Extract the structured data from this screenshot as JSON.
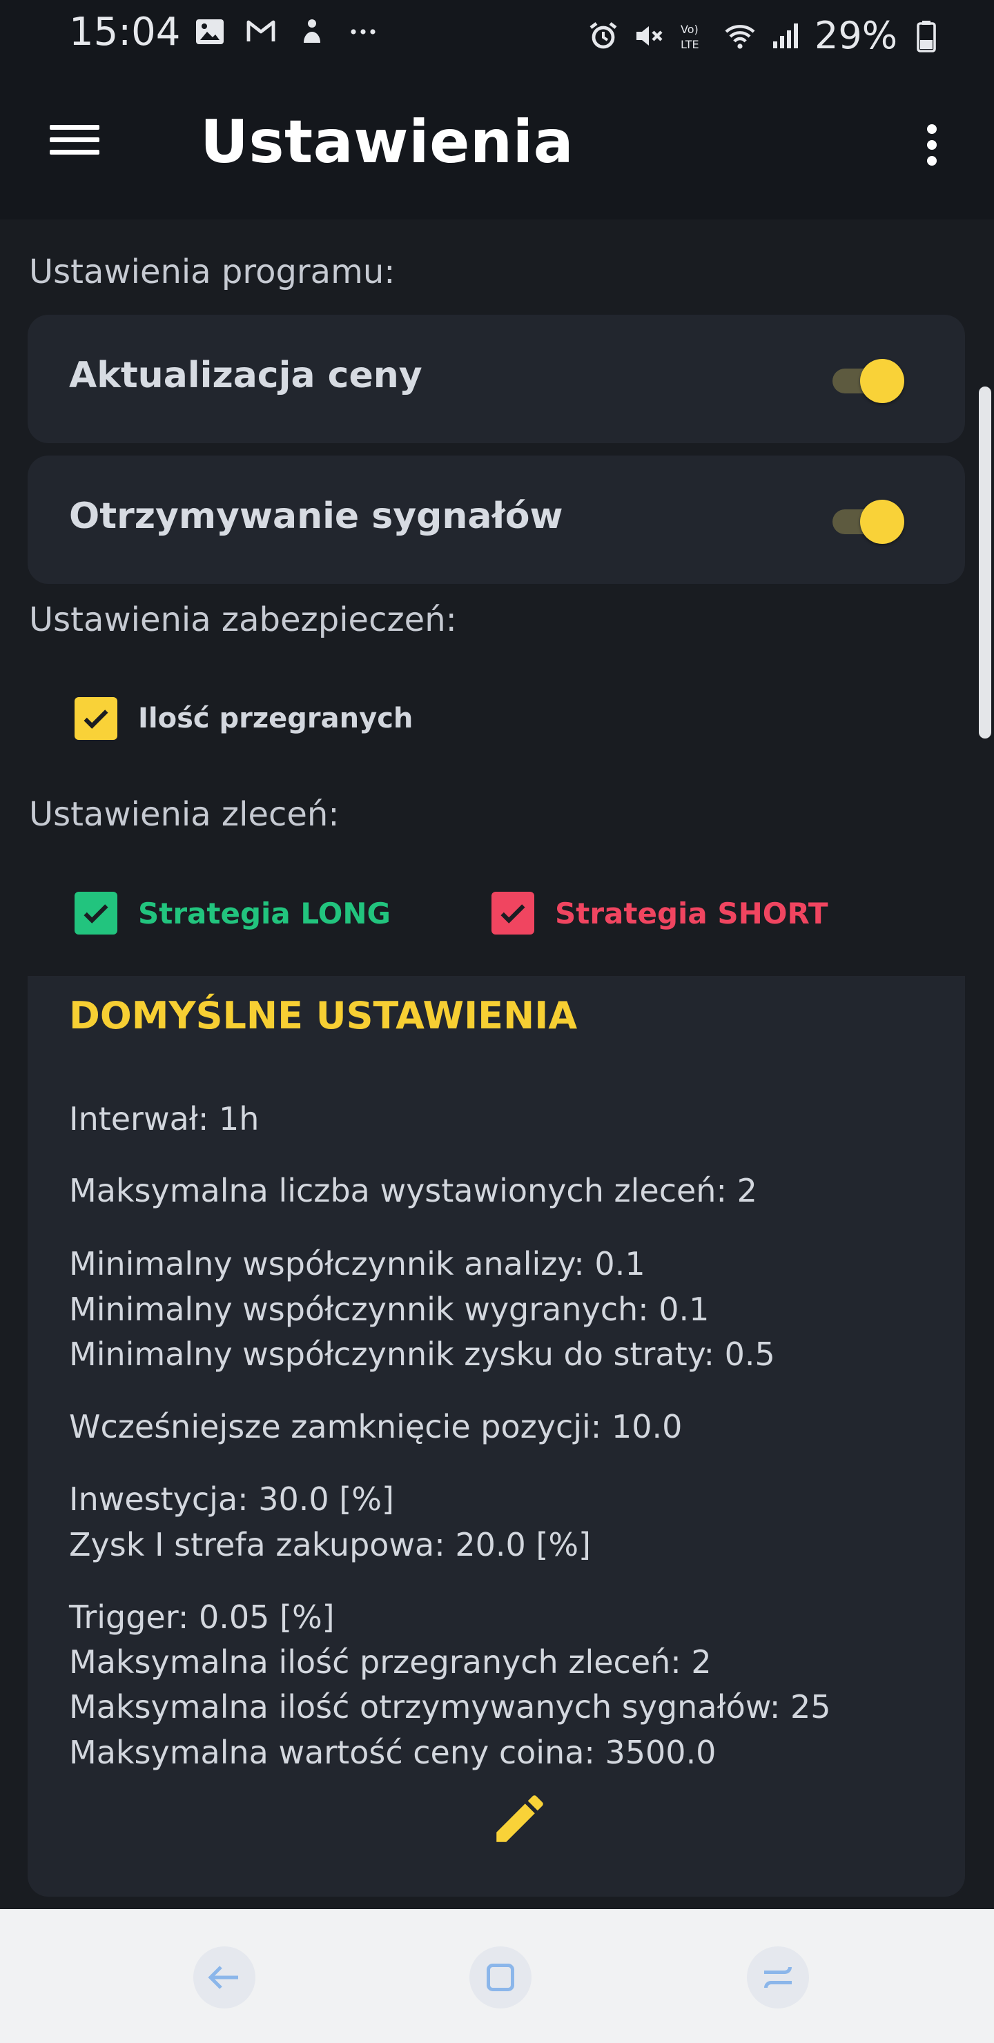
{
  "status_bar": {
    "time": "15:04",
    "battery": "29%",
    "left_icons": [
      "gallery-icon",
      "gmail-icon",
      "notification-icon",
      "more-dots-icon"
    ],
    "right_icons": [
      "alarm-icon",
      "mute-icon",
      "volte-icon",
      "wifi-icon",
      "signal-icon",
      "battery-icon"
    ]
  },
  "app_bar": {
    "title": "Ustawienia"
  },
  "program_settings": {
    "header": "Ustawienia programu:",
    "toggles": [
      {
        "label": "Aktualizacja ceny",
        "on": true
      },
      {
        "label": "Otrzymywanie sygnałów",
        "on": true
      }
    ]
  },
  "security_settings": {
    "header": "Ustawienia zabezpieczeń:",
    "checkbox": {
      "label": "Ilość przegranych",
      "checked": true
    }
  },
  "order_settings": {
    "header": "Ustawienia zleceń:",
    "long": {
      "label": "Strategia LONG",
      "checked": true
    },
    "short": {
      "label": "Strategia SHORT",
      "checked": true
    }
  },
  "defaults": {
    "title": "DOMYŚLNE USTAWIENIA",
    "lines": [
      "Interwał: 1h",
      "Maksymalna liczba wystawionych zleceń: 2",
      "Minimalny współczynnik analizy: 0.1",
      "Minimalny współczynnik wygranych: 0.1",
      "Minimalny współczynnik zysku do straty: 0.5",
      "Wcześniejsze zamknięcie pozycji: 10.0",
      "Inwestycja: 30.0 [%]",
      "Zysk I strefa zakupowa: 20.0 [%]",
      "Trigger: 0.05 [%]",
      "Maksymalna ilość przegranych zleceń: 2",
      "Maksymalna ilość otrzymywanych sygnałów: 25",
      "Maksymalna wartość ceny coina: 3500.0"
    ]
  },
  "colors": {
    "accent": "#f9d238",
    "long": "#22c47e",
    "short": "#f04560",
    "background": "#191c21",
    "card": "#22262e"
  }
}
